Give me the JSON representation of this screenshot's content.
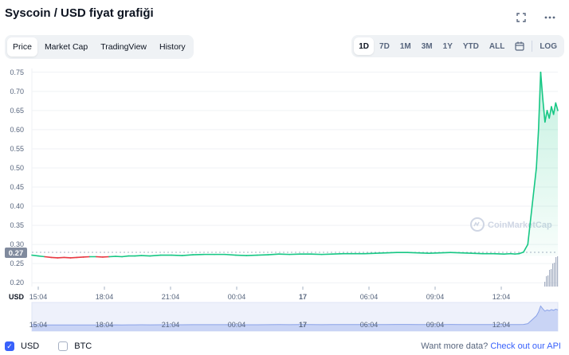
{
  "header": {
    "title": "Syscoin / USD fiyat grafiği"
  },
  "tabs": [
    {
      "label": "Price",
      "active": true
    },
    {
      "label": "Market Cap",
      "active": false
    },
    {
      "label": "TradingView",
      "active": false
    },
    {
      "label": "History",
      "active": false
    }
  ],
  "ranges": [
    {
      "label": "1D",
      "active": true
    },
    {
      "label": "7D",
      "active": false
    },
    {
      "label": "1M",
      "active": false
    },
    {
      "label": "3M",
      "active": false
    },
    {
      "label": "1Y",
      "active": false
    },
    {
      "label": "YTD",
      "active": false
    },
    {
      "label": "ALL",
      "active": false
    }
  ],
  "log_label": "LOG",
  "watermark": "CoinMarketCap",
  "currency_label": "USD",
  "colors": {
    "up": "#16c784",
    "down": "#ea3943",
    "accent": "#3861fb",
    "grid": "#eff2f5",
    "navigator": "#8aa2e8",
    "baseline_badge": "#808a9d"
  },
  "chart_data": {
    "type": "line",
    "y_ticks": [
      "0.75",
      "0.70",
      "0.65",
      "0.60",
      "0.55",
      "0.50",
      "0.45",
      "0.40",
      "0.35",
      "0.30",
      "0.25",
      "0.20"
    ],
    "ylim": [
      0.19,
      0.76
    ],
    "x_ticks": [
      "15:04",
      "18:04",
      "21:04",
      "00:04",
      "17",
      "06:04",
      "09:04",
      "12:04"
    ],
    "navigator_ticks": [
      "15:04",
      "18:04",
      "21:04",
      "00:04",
      "17",
      "06:04",
      "09:04",
      "12:04"
    ],
    "baseline_label": "0.27",
    "baseline_value": 0.27,
    "xlim": [
      0,
      24.5
    ],
    "series": [
      {
        "x": [
          0,
          0.3,
          0.6,
          0.9,
          1.2,
          1.5,
          1.8,
          2.1,
          2.4,
          2.7,
          3.0,
          3.3,
          3.6,
          3.9,
          4.2,
          4.5,
          4.8,
          5.1,
          5.5,
          6,
          6.5,
          7,
          7.5,
          8,
          8.5,
          9,
          9.5,
          10,
          10.5,
          11,
          11.5,
          12,
          12.5,
          13,
          13.5,
          14,
          14.5,
          15,
          15.5,
          16,
          16.5,
          17,
          17.5,
          18,
          18.5,
          19,
          19.5,
          20,
          20.5,
          21,
          21.5,
          22,
          22.3,
          22.5,
          22.7,
          22.9,
          23.1,
          23.3,
          23.5,
          23.6,
          23.7,
          23.8,
          23.9,
          24.0,
          24.1,
          24.2,
          24.3,
          24.4,
          24.5
        ],
        "y": [
          0.272,
          0.27,
          0.268,
          0.266,
          0.265,
          0.266,
          0.265,
          0.266,
          0.267,
          0.268,
          0.268,
          0.267,
          0.268,
          0.269,
          0.268,
          0.27,
          0.27,
          0.271,
          0.27,
          0.272,
          0.272,
          0.271,
          0.273,
          0.274,
          0.274,
          0.274,
          0.272,
          0.271,
          0.272,
          0.273,
          0.275,
          0.274,
          0.275,
          0.275,
          0.274,
          0.275,
          0.276,
          0.276,
          0.276,
          0.277,
          0.278,
          0.279,
          0.279,
          0.278,
          0.277,
          0.278,
          0.279,
          0.278,
          0.277,
          0.276,
          0.276,
          0.275,
          0.276,
          0.275,
          0.276,
          0.28,
          0.3,
          0.4,
          0.5,
          0.6,
          0.75,
          0.68,
          0.62,
          0.65,
          0.63,
          0.66,
          0.64,
          0.67,
          0.65
        ]
      }
    ]
  },
  "footer": {
    "usd_label": "USD",
    "btc_label": "BTC",
    "api_text": "Want more data?",
    "api_link": "Check out our API"
  }
}
